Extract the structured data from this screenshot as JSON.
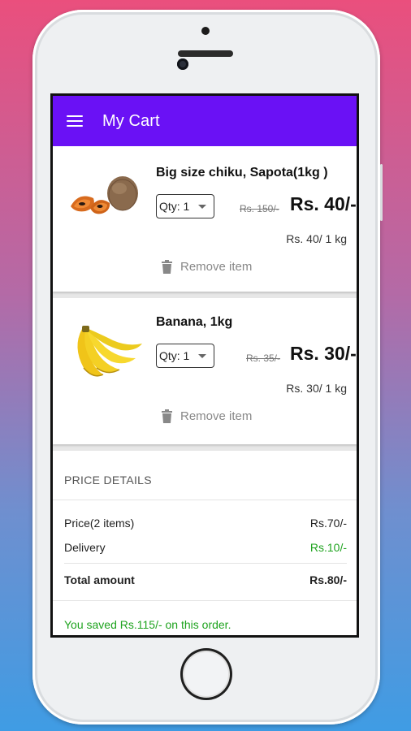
{
  "appbar": {
    "title": "My Cart"
  },
  "items": [
    {
      "name": "Big size chiku, Sapota(1kg )",
      "qty_label": "Qty: 1",
      "old_price": "Rs. 150/-",
      "new_price": "Rs. 40/-",
      "unit_price": "Rs. 40/ 1 kg",
      "remove_label": "Remove item",
      "image_icon": "sapota-fruit"
    },
    {
      "name": "Banana, 1kg",
      "qty_label": "Qty: 1",
      "old_price": "Rs. 35/-",
      "new_price": "Rs. 30/-",
      "unit_price": "Rs. 30/ 1 kg",
      "remove_label": "Remove item",
      "image_icon": "banana-bunch"
    }
  ],
  "price_details": {
    "title": "PRICE DETAILS",
    "price_label": "Price(2 items)",
    "price_value": "Rs.70/-",
    "delivery_label": "Delivery",
    "delivery_value": "Rs.10/-",
    "total_label": "Total amount",
    "total_value": "Rs.80/-",
    "saved_text": "You saved Rs.115/- on this order."
  },
  "colors": {
    "appbar": "#6a11f5",
    "savings_green": "#1ea31e"
  }
}
